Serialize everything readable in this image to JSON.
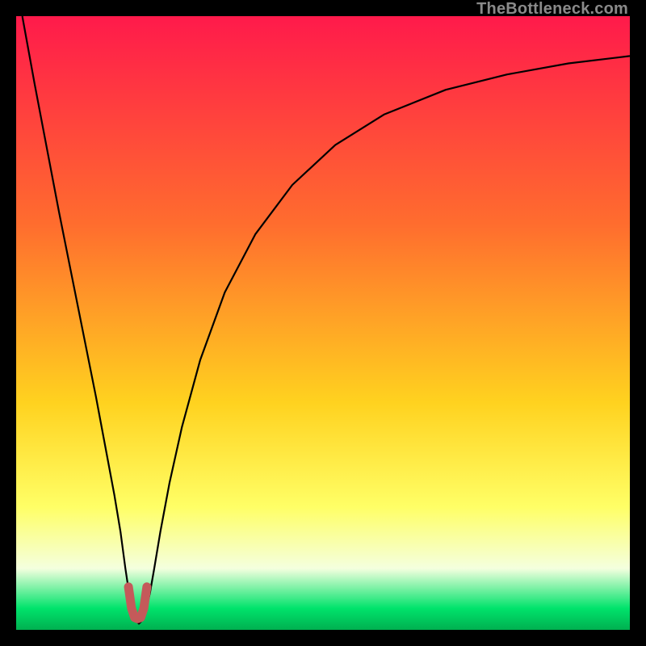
{
  "watermark": "TheBottleneck.com",
  "chart_data": {
    "type": "line",
    "title": "",
    "xlabel": "",
    "ylabel": "",
    "xlim": [
      0,
      100
    ],
    "ylim": [
      0,
      100
    ],
    "background_gradient": [
      {
        "stop": 0.0,
        "color": "#ff1a4b"
      },
      {
        "stop": 0.34,
        "color": "#ff6d2e"
      },
      {
        "stop": 0.63,
        "color": "#ffd21f"
      },
      {
        "stop": 0.8,
        "color": "#ffff66"
      },
      {
        "stop": 0.9,
        "color": "#f4ffde"
      },
      {
        "stop": 0.965,
        "color": "#00e36b"
      },
      {
        "stop": 1.0,
        "color": "#00b050"
      }
    ],
    "series": [
      {
        "name": "bottleneck-curve",
        "color": "#000000",
        "width": 2.2,
        "x": [
          1.0,
          3.0,
          5.0,
          7.0,
          9.0,
          11.0,
          13.0,
          14.5,
          16.0,
          17.0,
          17.8,
          18.4,
          19.0,
          19.5,
          20.0,
          20.5,
          21.1,
          21.8,
          22.5,
          23.5,
          25.0,
          27.0,
          30.0,
          34.0,
          39.0,
          45.0,
          52.0,
          60.0,
          70.0,
          80.0,
          90.0,
          100.0
        ],
        "y": [
          100.0,
          89.0,
          78.5,
          68.0,
          58.0,
          48.0,
          38.0,
          30.0,
          22.0,
          16.0,
          10.0,
          6.0,
          3.0,
          1.5,
          1.0,
          1.5,
          3.0,
          6.0,
          10.0,
          16.0,
          24.0,
          33.0,
          44.0,
          55.0,
          64.5,
          72.5,
          79.0,
          84.0,
          88.0,
          90.5,
          92.3,
          93.5
        ]
      },
      {
        "name": "highlight-marker",
        "type": "marker-path",
        "color": "#c45a5a",
        "width": 11,
        "linecap": "round",
        "x": [
          18.3,
          18.8,
          19.3,
          19.8,
          20.3,
          20.8,
          21.3
        ],
        "y": [
          7.0,
          3.5,
          2.0,
          1.8,
          2.0,
          3.5,
          7.0
        ]
      }
    ]
  }
}
